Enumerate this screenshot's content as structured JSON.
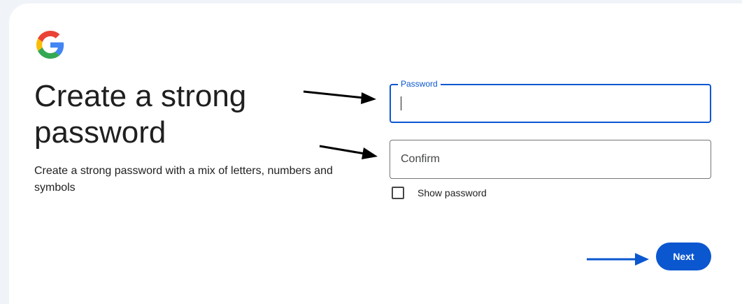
{
  "page": {
    "title": "Create a strong password",
    "subtitle": "Create a strong password with a mix of letters, numbers and symbols"
  },
  "password_field": {
    "label": "Password",
    "value": ""
  },
  "confirm_field": {
    "placeholder": "Confirm",
    "value": ""
  },
  "show_password": {
    "label": "Show password",
    "checked": false
  },
  "next_button": {
    "label": "Next"
  },
  "icons": {
    "logo": "google-g-logo",
    "annotation_arrows": [
      "black-arrow",
      "black-arrow",
      "blue-arrow"
    ]
  },
  "colors": {
    "accent": "#0b57d0",
    "background": "#f0f4f9",
    "card": "#ffffff",
    "text": "#1f1f1f",
    "arrow_black": "#000000",
    "arrow_blue": "#0b57d0"
  }
}
